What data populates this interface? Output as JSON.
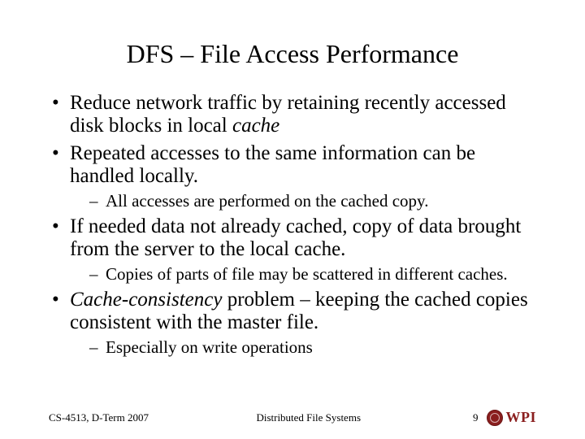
{
  "title": "DFS – File Access Performance",
  "bullets": [
    {
      "text_before_italic": "Reduce network traffic by retaining recently accessed disk blocks in local ",
      "italic": "cache",
      "text_after_italic": "",
      "sub": []
    },
    {
      "text_before_italic": "Repeated accesses to the same information can be handled locally.",
      "italic": "",
      "text_after_italic": "",
      "sub": [
        "All accesses are performed on the cached copy."
      ]
    },
    {
      "text_before_italic": "If needed data not already cached, copy of data brought from the server to the local cache.",
      "italic": "",
      "text_after_italic": "",
      "sub": [
        "Copies of parts of file may be scattered in different caches."
      ]
    },
    {
      "text_before_italic": "",
      "italic": "Cache-consistency",
      "text_after_italic": " problem – keeping the cached copies consistent with the master file.",
      "sub": [
        "Especially on write operations"
      ]
    }
  ],
  "footer": {
    "left": "CS-4513, D-Term 2007",
    "center": "Distributed File Systems",
    "page": "9",
    "logo_text": "WPI"
  }
}
